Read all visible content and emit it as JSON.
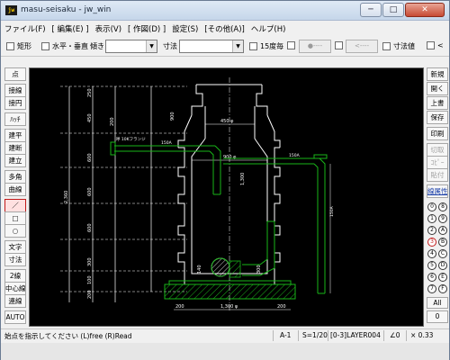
{
  "window": {
    "title": "masu-seisaku - jw_win",
    "icon_text": "jw",
    "min_glyph": "─",
    "max_glyph": "□",
    "close_glyph": "✕"
  },
  "menu": [
    "ファイル(F)",
    "[ 編集(E) ]",
    "表示(V)",
    "[ 作図(D) ]",
    "設定(S)",
    "[その他(A)]",
    "ヘルプ(H)"
  ],
  "toolbar": {
    "rect_label": "矩形",
    "hv_label": "水平・垂直",
    "slope_label": "傾き",
    "dim_label": "寸法",
    "deg15_label": "15度毎",
    "circle_btn": "●----",
    "arrow_btn": "<----",
    "dimval_label": "寸法値",
    "lt_label": "<"
  },
  "left_tools": [
    "点",
    "接線",
    "接円",
    "ﾊｯﾁ",
    "建平",
    "建断",
    "建立",
    "多角",
    "曲線",
    "／",
    "□",
    "○",
    "文字",
    "寸法",
    "2線",
    "中心線",
    "連線",
    "AUTO"
  ],
  "right_tools": [
    "新規",
    "開く",
    "上書",
    "保存",
    "印刷",
    "切取",
    "ｺﾋﾟｰ",
    "貼付",
    "線属性"
  ],
  "layer_buttons": [
    "0",
    "8",
    "1",
    "9",
    "2",
    "A",
    "3",
    "B",
    "4",
    "C",
    "5",
    "D",
    "6",
    "E",
    "7",
    "F"
  ],
  "right_bottom": {
    "all": "All",
    "zero": "0"
  },
  "status": {
    "message": "始点を指示してください (L)free (R)Read",
    "paper": "A-1",
    "scale": "S=1/20",
    "layer": "[0-3]LAYER004",
    "angle": "∠0",
    "zoom": "× 0.33"
  },
  "drawing": {
    "flange_label": "呼 10Kフランジ",
    "pipe_label_1": "150A",
    "pipe_label_2": "150A",
    "vert_pipe_label": "150A",
    "dim_top": "450 φ",
    "dim_mid": "900 φ",
    "dim_base": "1,300 φ",
    "dim_bottom_left": "200",
    "dim_bottom_right": "200",
    "dim_900": "900",
    "dim_1300": "1,300",
    "dim_2360": "2,360",
    "dim_300": "300",
    "left_dims": [
      "250",
      "450",
      "600",
      "600",
      "600",
      "300",
      "100",
      "200",
      "200"
    ],
    "dim_140": "140",
    "dim_150": "150"
  }
}
